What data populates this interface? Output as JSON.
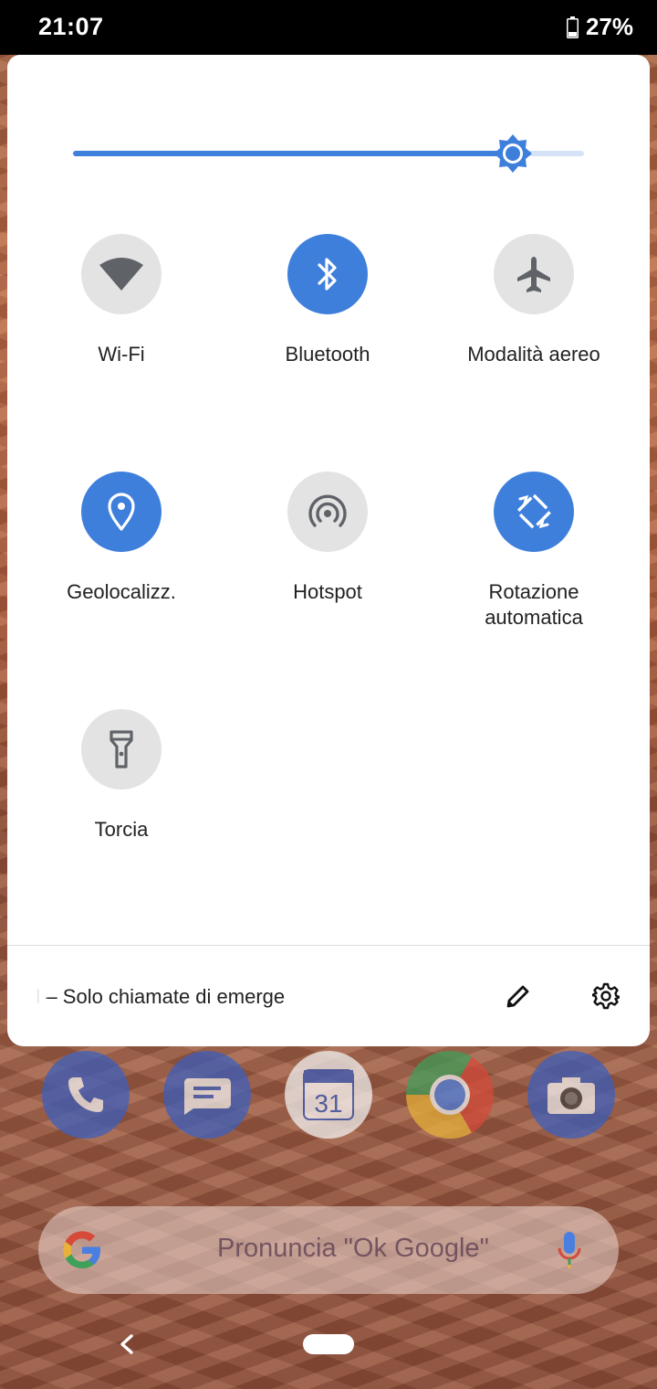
{
  "status_bar": {
    "time": "21:07",
    "battery": "27%",
    "battery_level": 0.27
  },
  "brightness": {
    "level": 0.86
  },
  "tiles": [
    {
      "label": "Wi-Fi",
      "icon": "wifi-icon",
      "active": false
    },
    {
      "label": "Bluetooth",
      "icon": "bluetooth-icon",
      "active": true
    },
    {
      "label": "Modalità aereo",
      "icon": "airplane-icon",
      "active": false
    },
    {
      "label": "Geolocalizz.",
      "icon": "location-icon",
      "active": true
    },
    {
      "label": "Hotspot",
      "icon": "hotspot-icon",
      "active": false
    },
    {
      "label": "Rotazione automatica",
      "icon": "auto-rotate-icon",
      "active": true
    },
    {
      "label": "Torcia",
      "icon": "flashlight-icon",
      "active": false
    }
  ],
  "footer": {
    "carrier_text": "M – Solo chiamate di emerge",
    "edit_icon": "pencil-icon",
    "settings_icon": "gear-icon"
  },
  "dock": {
    "apps": [
      {
        "name": "phone-app-icon"
      },
      {
        "name": "messages-app-icon"
      },
      {
        "name": "calendar-app-icon",
        "label": "31"
      },
      {
        "name": "chrome-app-icon"
      },
      {
        "name": "camera-app-icon"
      }
    ]
  },
  "search": {
    "placeholder": "Pronuncia \"Ok Google\""
  },
  "colors": {
    "accent": "#3f7fdc",
    "tile_off": "#e3e3e3",
    "icon_off": "#5f6368"
  }
}
